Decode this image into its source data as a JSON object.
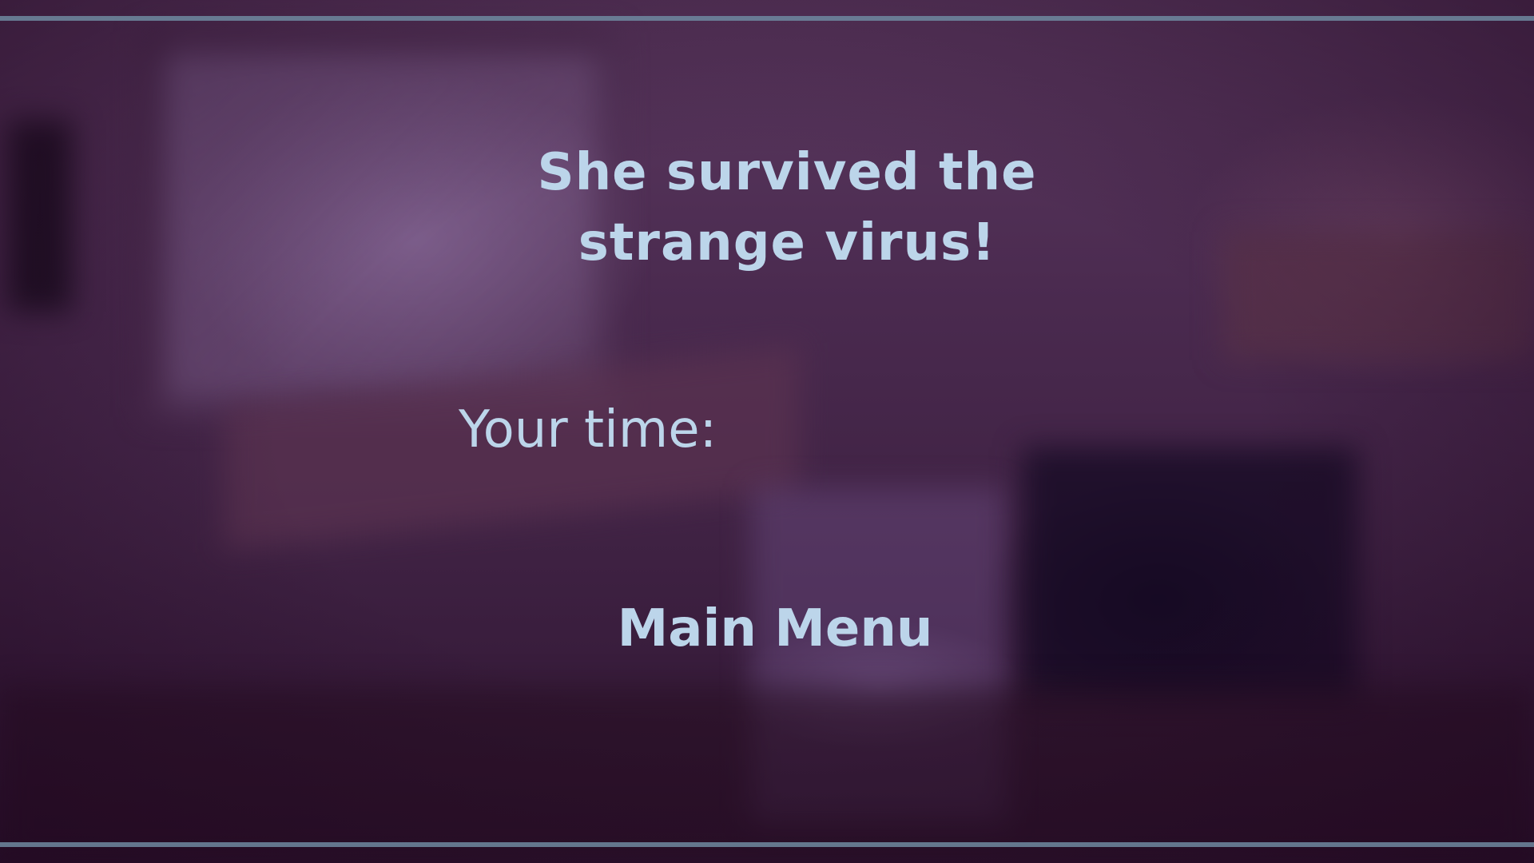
{
  "end_screen": {
    "title": "She survived the strange virus!",
    "time_label": "Your time:",
    "main_menu_label": "Main Menu"
  },
  "colors": {
    "text": "#bcd5ea",
    "frame_bar": "#6f8aa0",
    "background_tint": "#4a2a4f"
  }
}
